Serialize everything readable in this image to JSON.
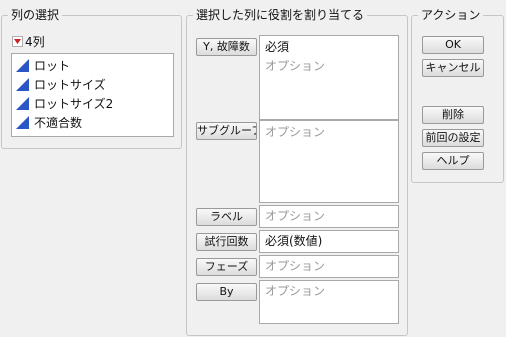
{
  "column_select": {
    "legend": "列の選択",
    "count_label": "4列",
    "columns": [
      {
        "label": "ロット"
      },
      {
        "label": "ロットサイズ"
      },
      {
        "label": "ロットサイズ2"
      },
      {
        "label": "不適合数"
      }
    ]
  },
  "assign_roles": {
    "legend": "選択した列に役割を割り当てる",
    "roles": [
      {
        "button": "Y, 故障数",
        "values": [
          "必須",
          "オプション"
        ]
      },
      {
        "button": "サブグループ",
        "values": [
          "オプション"
        ]
      },
      {
        "button": "ラベル",
        "values": [
          "オプション"
        ]
      },
      {
        "button": "試行回数",
        "values": [
          "必須(数値)"
        ]
      },
      {
        "button": "フェーズ",
        "values": [
          "オプション"
        ]
      },
      {
        "button": "By",
        "values": [
          "オプション"
        ]
      }
    ]
  },
  "actions": {
    "legend": "アクション",
    "ok": "OK",
    "cancel": "キャンセル",
    "remove": "削除",
    "recall": "前回の設定",
    "help": "ヘルプ"
  },
  "colors": {
    "accent_blue": "#2a56c6",
    "dropdown_red": "#cc2222"
  },
  "icons": {
    "column_type": "continuous-triangle-icon",
    "count_menu": "red-triangle-menu-icon"
  }
}
